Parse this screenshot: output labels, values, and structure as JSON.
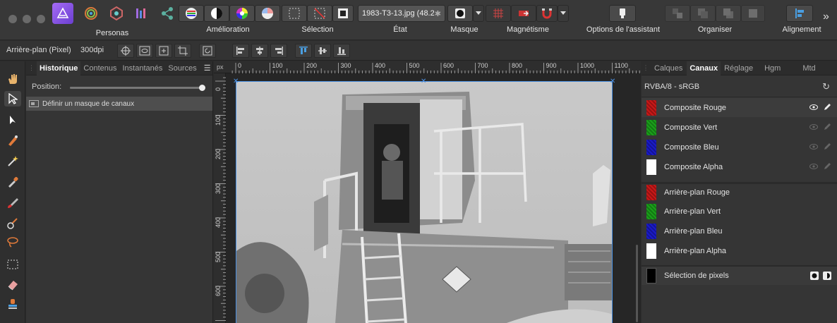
{
  "toolbar": {
    "personas_label": "Personas",
    "groups": {
      "amelioration": "Amélioration",
      "selection": "Sélection",
      "etat": "État",
      "masque": "Masque",
      "magnetisme": "Magnétisme",
      "options": "Options de l'assistant",
      "organiser": "Organiser",
      "alignement": "Alignement"
    },
    "document_name": "1983-T3-13.jpg (48.2",
    "overflow": "»"
  },
  "context_bar": {
    "layer_label": "Arrière-plan (Pixel)",
    "dpi": "300dpi"
  },
  "left_panel": {
    "tabs": [
      "Historique",
      "Contenus",
      "Instantanés",
      "Sources"
    ],
    "position_label": "Position:",
    "position_fraction": 1.0,
    "history_items": [
      "Définir un masque de canaux"
    ]
  },
  "ruler": {
    "unit": "px",
    "h_ticks": [
      "0",
      "100",
      "200",
      "300",
      "400",
      "500",
      "600",
      "700",
      "800",
      "900",
      "1000",
      "1100"
    ],
    "v_ticks": [
      "0",
      "100",
      "200",
      "300",
      "400",
      "500",
      "600"
    ]
  },
  "right_panel": {
    "tabs": [
      "Calques",
      "Canaux",
      "Réglage",
      "Hgm",
      "Mtd"
    ],
    "format": "RVBA/8 - sRGB",
    "channels": [
      {
        "label": "Composite Rouge",
        "color": "#c81818"
      },
      {
        "label": "Composite Vert",
        "color": "#1aa01a"
      },
      {
        "label": "Composite Bleu",
        "color": "#1a1ac8"
      },
      {
        "label": "Composite Alpha",
        "color": "#ffffff"
      },
      {
        "label": "Arrière-plan Rouge",
        "color": "#c81818"
      },
      {
        "label": "Arrière-plan Vert",
        "color": "#1aa01a"
      },
      {
        "label": "Arrière-plan Bleu",
        "color": "#1a1ac8"
      },
      {
        "label": "Arrière-plan Alpha",
        "color": "#ffffff"
      }
    ],
    "selection_label": "Sélection de pixels"
  },
  "colors": {
    "accent": "#3a7bd5",
    "affinity_purple": "#8b5cf6"
  }
}
